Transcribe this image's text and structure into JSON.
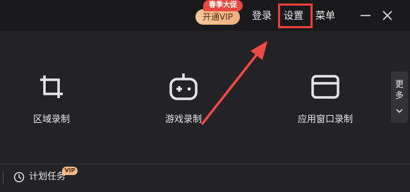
{
  "titlebar": {
    "vip_button": "开通VIP",
    "promo_badge": "春季大促",
    "login": "登录",
    "settings": "设置",
    "menu": "菜单",
    "minimize_icon": "minimize-icon",
    "close_icon": "close-icon"
  },
  "modes": [
    {
      "label": "区域录制",
      "icon": "crop-icon"
    },
    {
      "label": "游戏录制",
      "icon": "gamepad-icon"
    },
    {
      "label": "应用窗口录制",
      "icon": "window-icon"
    }
  ],
  "more": {
    "label": "更多",
    "icon": "chevron-down-icon"
  },
  "footer": {
    "schedule_label": "计划任务",
    "vip_tag": "VIP",
    "icon": "clock-icon"
  },
  "colors": {
    "background": "#232326",
    "titlebar": "#1a1a1c",
    "highlight": "#e8403a",
    "vip_gradient_start": "#f6c89a",
    "promo": "#e8483f"
  }
}
